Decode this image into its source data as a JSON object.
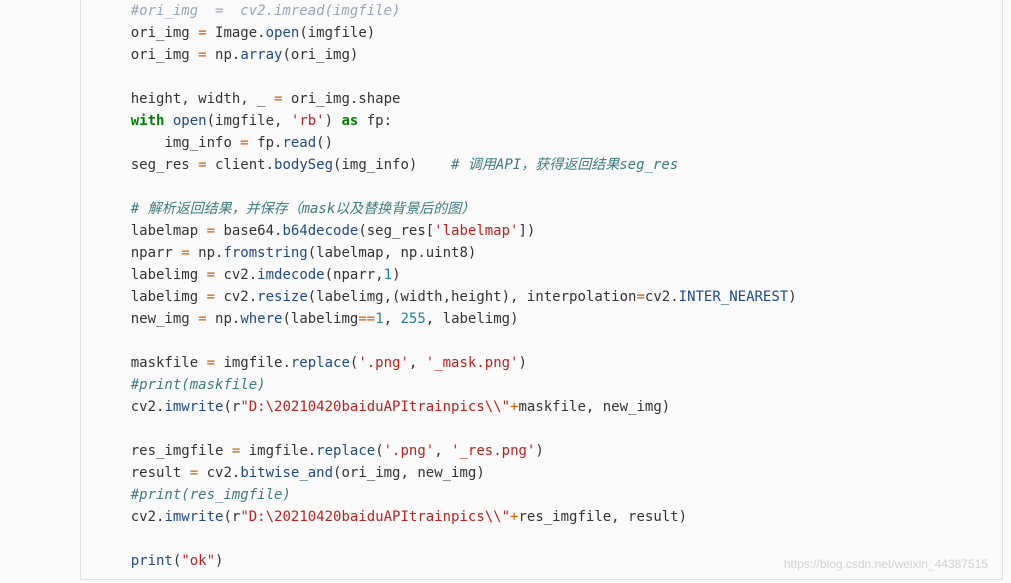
{
  "watermark": "https://blog.csdn.net/weixin_44387515",
  "lines": {
    "l0a": "    #ori_img  =  cv2.imread(imgfile)",
    "l1": {
      "indent": "    ",
      "a": "ori_img ",
      "op1": "=",
      "b": " Image.",
      "call": "open",
      "c": "(imgfile)"
    },
    "l2": {
      "indent": "    ",
      "a": "ori_img ",
      "op1": "=",
      "b": " np.",
      "call": "array",
      "c": "(ori_img)"
    },
    "l3": {
      "indent": "    ",
      "a": "height, width, _ ",
      "op1": "=",
      "b": " ori_img.shape"
    },
    "l4": {
      "indent": "    ",
      "kw1": "with",
      "a": " ",
      "call": "open",
      "b": "(imgfile, ",
      "str": "'rb'",
      "c": ") ",
      "kw2": "as",
      "d": " fp:"
    },
    "l5": {
      "indent": "        ",
      "a": "img_info ",
      "op1": "=",
      "b": " fp.",
      "call": "read",
      "c": "()"
    },
    "l6": {
      "indent": "    ",
      "a": "seg_res ",
      "op1": "=",
      "b": " client.",
      "call": "bodySeg",
      "c": "(img_info)    ",
      "comment": "# 调用API，获得返回结果seg_res"
    },
    "l7": {
      "indent": "    ",
      "comment": "# 解析返回结果，并保存（mask以及替换背景后的图）"
    },
    "l8": {
      "indent": "    ",
      "a": "labelmap ",
      "op1": "=",
      "b": " base64.",
      "call": "b64decode",
      "c": "(seg_res[",
      "str": "'labelmap'",
      "d": "])"
    },
    "l9": {
      "indent": "    ",
      "a": "nparr ",
      "op1": "=",
      "b": " np.",
      "call": "fromstring",
      "c": "(labelmap, np.uint8)"
    },
    "l10": {
      "indent": "    ",
      "a": "labelimg ",
      "op1": "=",
      "b": " cv2.",
      "call": "imdecode",
      "c": "(nparr,",
      "num": "1",
      "d": ")"
    },
    "l11": {
      "indent": "    ",
      "a": "labelimg ",
      "op1": "=",
      "b": " cv2.",
      "call": "resize",
      "c": "(labelimg,(width,height), interpolation",
      "op2": "=",
      "d": "cv2.",
      "const": "INTER_NEAREST",
      "e": ")"
    },
    "l12": {
      "indent": "    ",
      "a": "new_img ",
      "op1": "=",
      "b": " np.",
      "call": "where",
      "c": "(labelimg",
      "op2": "==",
      "num": "1",
      "d": ", ",
      "num2": "255",
      "e": ", labelimg)"
    },
    "l13": {
      "indent": "    ",
      "a": "maskfile ",
      "op1": "=",
      "b": " imgfile.",
      "call": "replace",
      "c": "(",
      "str1": "'.png'",
      "d": ", ",
      "str2": "'_mask.png'",
      "e": ")"
    },
    "l14": {
      "indent": "    ",
      "comment": "#print(maskfile)"
    },
    "l15": {
      "indent": "    ",
      "a": "cv2.",
      "call": "imwrite",
      "b": "(r",
      "str": "\"D:\\20210420baiduAPItrainpics\\\\\"",
      "op": "+",
      "c": "maskfile, new_img)"
    },
    "l16": {
      "indent": "    ",
      "a": "res_imgfile ",
      "op1": "=",
      "b": " imgfile.",
      "call": "replace",
      "c": "(",
      "str1": "'.png'",
      "d": ", ",
      "str2": "'_res.png'",
      "e": ")"
    },
    "l17": {
      "indent": "    ",
      "a": "result ",
      "op1": "=",
      "b": " cv2.",
      "call": "bitwise_and",
      "c": "(ori_img, new_img)"
    },
    "l18": {
      "indent": "    ",
      "comment": "#print(res_imgfile)"
    },
    "l19": {
      "indent": "    ",
      "a": "cv2.",
      "call": "imwrite",
      "b": "(r",
      "str": "\"D:\\20210420baiduAPItrainpics\\\\\"",
      "op": "+",
      "c": "res_imgfile, result)"
    },
    "l20": {
      "indent": "    ",
      "call": "print",
      "a": "(",
      "str": "\"ok\"",
      "b": ")"
    }
  }
}
